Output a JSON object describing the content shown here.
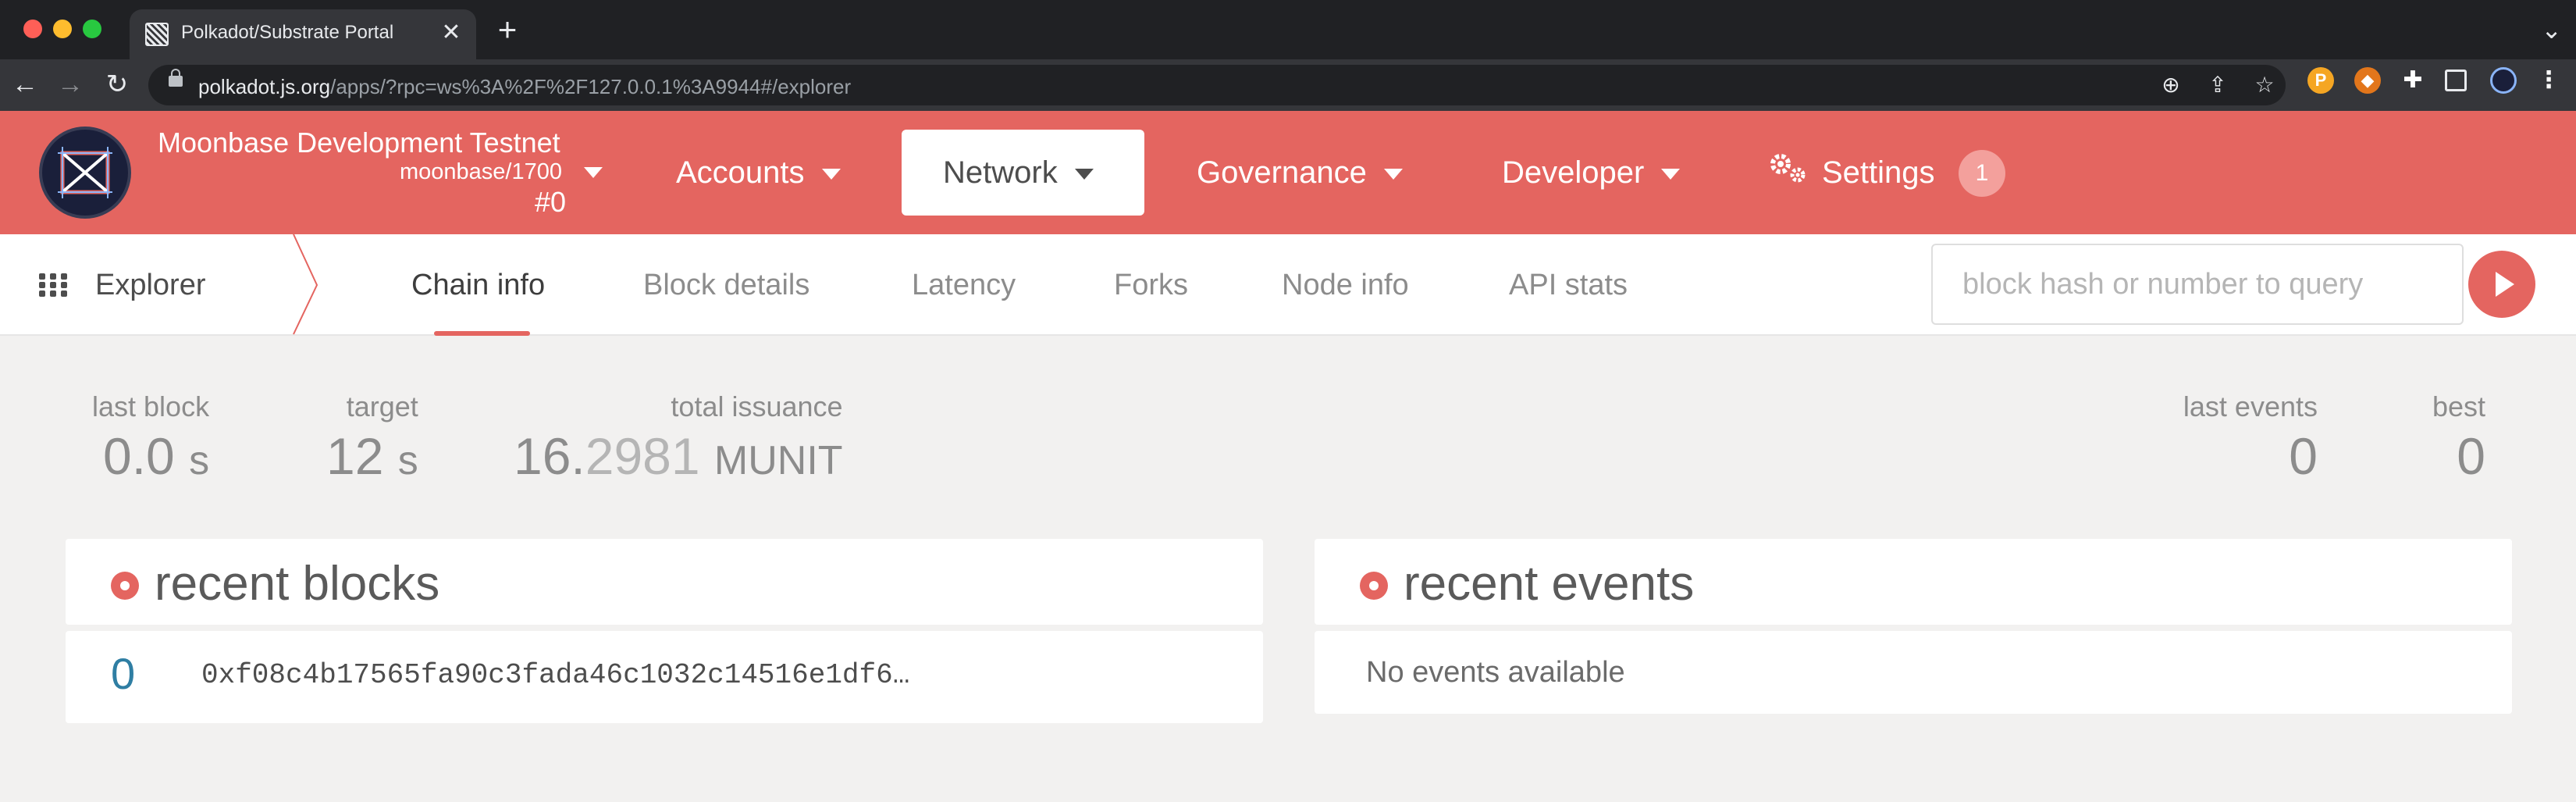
{
  "browser": {
    "tab_title": "Polkadot/Substrate Portal",
    "tab_close": "✕",
    "new_tab": "+",
    "url_host": "polkadot.js.org",
    "url_path": "/apps/?rpc=ws%3A%2F%2F127.0.0.1%3A9944#/explorer",
    "extensions": [
      "metamask-icon",
      "puzzle-icon",
      "sidebar-icon",
      "profile-icon"
    ]
  },
  "header": {
    "chain_name": "Moonbase Development Testnet",
    "chain_spec": "moonbase/1700",
    "block_number": "#0",
    "menu": {
      "accounts": "Accounts",
      "network": "Network",
      "governance": "Governance",
      "developer": "Developer",
      "settings": "Settings",
      "settings_badge": "1"
    },
    "brand_color": "#e46560"
  },
  "subnav": {
    "section": "Explorer",
    "tabs": [
      "Chain info",
      "Block details",
      "Latency",
      "Forks",
      "Node info",
      "API stats"
    ],
    "active_tab": "Chain info",
    "query_placeholder": "block hash or number to query"
  },
  "summary": {
    "last_block": {
      "label": "last block",
      "value": "0.0",
      "unit": "s"
    },
    "target": {
      "label": "target",
      "value": "12",
      "unit": "s"
    },
    "total_issuance": {
      "label": "total issuance",
      "integer": "16.",
      "decimals": "2981",
      "unit": "MUNIT"
    },
    "last_events": {
      "label": "last events",
      "value": "0"
    },
    "best": {
      "label": "best",
      "value": "0"
    }
  },
  "recent_blocks": {
    "title": "recent blocks",
    "rows": [
      {
        "number": "0",
        "hash": "0xf08c4b17565fa90c3fada46c1032c14516e1df6…"
      }
    ]
  },
  "recent_events": {
    "title": "recent events",
    "empty_text": "No events available"
  }
}
